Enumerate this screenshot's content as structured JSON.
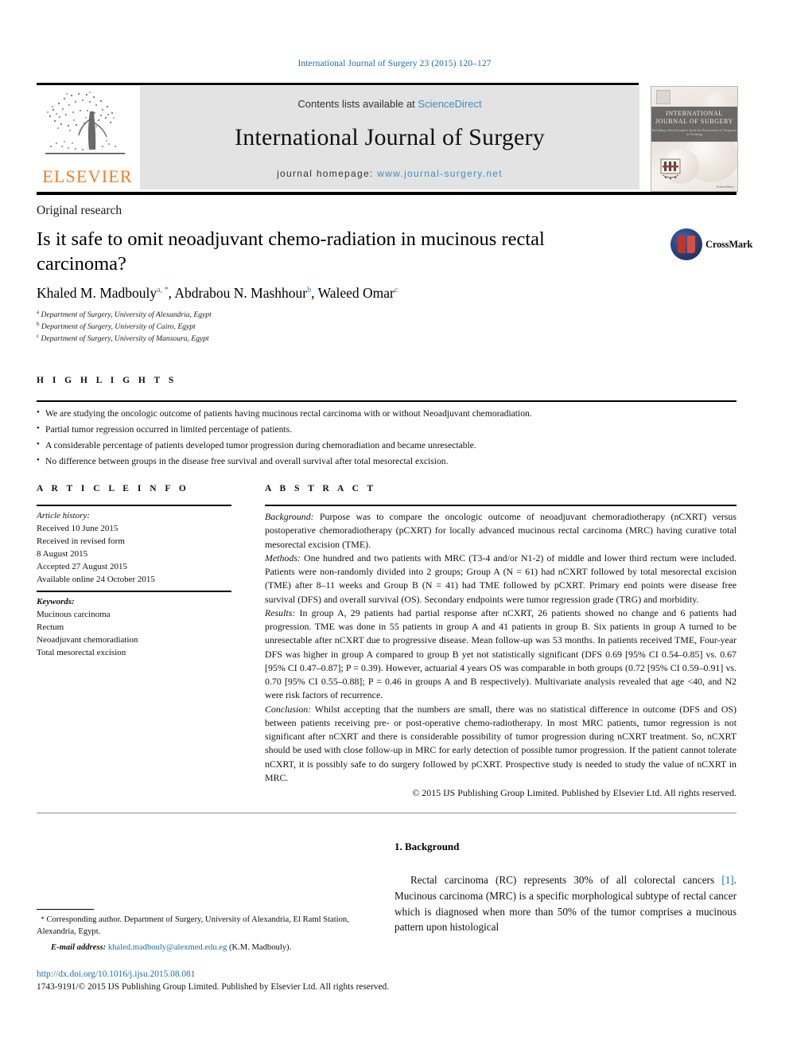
{
  "running_head": "International Journal of Surgery 23 (2015) 120–127",
  "masthead": {
    "publisher_name": "ELSEVIER",
    "contents_prefix": "Contents lists available at ",
    "contents_link": "ScienceDirect",
    "journal_title": "International Journal of Surgery",
    "homepage_prefix": "journal homepage: ",
    "homepage_url": "www.journal-surgery.net",
    "cover": {
      "title_line1": "INTERNATIONAL",
      "title_line2": "JOURNAL OF SURGERY",
      "subtitle": "Including selected papers from the Association of Surgeons in Training"
    }
  },
  "article": {
    "kind": "Original research",
    "title": "Is it safe to omit neoadjuvant chemo-radiation in mucinous rectal carcinoma?",
    "authors": [
      {
        "name": "Khaled M. Madbouly",
        "marks": "a, *"
      },
      {
        "name": "Abdrabou N. Mashhour",
        "marks": "b"
      },
      {
        "name": "Waleed Omar",
        "marks": "c"
      }
    ],
    "affiliations": [
      {
        "mark": "a",
        "text": "Department of Surgery, University of Alexandria, Egypt"
      },
      {
        "mark": "b",
        "text": "Department of Surgery, University of Cairo, Egypt"
      },
      {
        "mark": "c",
        "text": "Department of Surgery, University of Mansoura, Egypt"
      }
    ],
    "crossmark_label": "CrossMark"
  },
  "highlights": {
    "label": "H I G H L I G H T S",
    "items": [
      "We are studying the oncologic outcome of patients having mucinous rectal carcinoma with or without Neoadjuvant chemoradiation.",
      "Partial tumor regression occurred in limited percentage of patients.",
      "A considerable percentage of patients developed tumor progression during chemoradiation and became unresectable.",
      "No difference between groups in the disease free survival and overall survival after total mesorectal excision."
    ]
  },
  "article_info": {
    "label": "A R T I C L E  I N F O",
    "history_heading": "Article history:",
    "history_lines": [
      "Received 10 June 2015",
      "Received in revised form",
      "8 August 2015",
      "Accepted 27 August 2015",
      "Available online 24 October 2015"
    ],
    "keywords_heading": "Keywords:",
    "keywords": [
      "Mucinous carcinoma",
      "Rectum",
      "Neoadjuvant chemoradiation",
      "Total mesorectal excision"
    ]
  },
  "abstract": {
    "label": "A B S T R A C T",
    "background_lead": "Background:",
    "background_text": " Purpose was to compare the oncologic outcome of neoadjuvant chemoradiotherapy (nCXRT) versus postoperative chemoradiotherapy (pCXRT) for locally advanced mucinous rectal carcinoma (MRC) having curative total mesorectal excision (TME).",
    "methods_lead": "Methods:",
    "methods_text": " One hundred and two patients with MRC (T3-4 and/or N1-2) of middle and lower third rectum were included. Patients were non-randomly divided into 2 groups; Group A (N = 61) had nCXRT followed by total mesorectal excision (TME) after 8–11 weeks and Group B (N = 41) had TME followed by pCXRT. Primary end points were disease free survival (DFS) and overall survival (OS). Secondary endpoints were tumor regression grade (TRG) and morbidity.",
    "results_lead": "Results:",
    "results_text": " In group A, 29 patients had partial response after nCXRT, 26 patients showed no change and 6 patients had progression. TME was done in 55 patients in group A and 41 patients in group B. Six patients in group A turned to be unresectable after nCXRT due to progressive disease. Mean follow-up was 53 months. In patients received TME, Four-year DFS was higher in group A compared to group B yet not statistically significant (DFS 0.69 [95% CI 0.54–0.85] vs. 0.67 [95% CI 0.47–0.87]; P = 0.39). However, actuarial 4 years OS was comparable in both groups (0.72 [95% CI 0.59–0.91] vs. 0.70 [95% CI 0.55–0.88]; P = 0.46 in groups A and B respectively). Multivariate analysis revealed that age <40, and N2 were risk factors of recurrence.",
    "conclusion_lead": "Conclusion:",
    "conclusion_text": " Whilst accepting that the numbers are small, there was no statistical difference in outcome (DFS and OS) between patients receiving pre- or post-operative chemo-radiotherapy. In most MRC patients, tumor regression is not significant after nCXRT and there is considerable possibility of tumor progression during nCXRT treatment. So, nCXRT should be used with close follow-up in MRC for early detection of possible tumor progression. If the patient cannot tolerate nCXRT, it is possibly safe to do surgery followed by pCXRT. Prospective study is needed to study the value of nCXRT in MRC.",
    "copyright": "© 2015 IJS Publishing Group Limited. Published by Elsevier Ltd. All rights reserved."
  },
  "body": {
    "section_number_title": "1. Background",
    "paragraph_part1": "Rectal carcinoma (RC) represents 30% of all colorectal cancers ",
    "reference_marker": "[1]",
    "paragraph_part2": ". Mucinous carcinoma (MRC) is a specific morphological subtype of rectal cancer which is diagnosed when more than 50% of the tumor comprises a mucinous pattern upon histological"
  },
  "footnotes": {
    "corresponding_star": "*",
    "corresponding_text": " Corresponding author. Department of Surgery, University of Alexandria, El Raml Station, Alexandria, Egypt.",
    "email_label": "E-mail address:",
    "email_address": "khaled.madbouly@alexmed.edu.eg",
    "email_suffix": " (K.M. Madbouly).",
    "doi": "http://dx.doi.org/10.1016/j.ijsu.2015.08.081",
    "issn_line": "1743-9191/© 2015 IJS Publishing Group Limited. Published by Elsevier Ltd. All rights reserved."
  },
  "colors": {
    "link_blue": "#1a6fa8",
    "sciencedirect_blue": "#3c8ec4",
    "elsevier_orange": "#ef7d22",
    "band_gray": "#e3e3e3"
  }
}
